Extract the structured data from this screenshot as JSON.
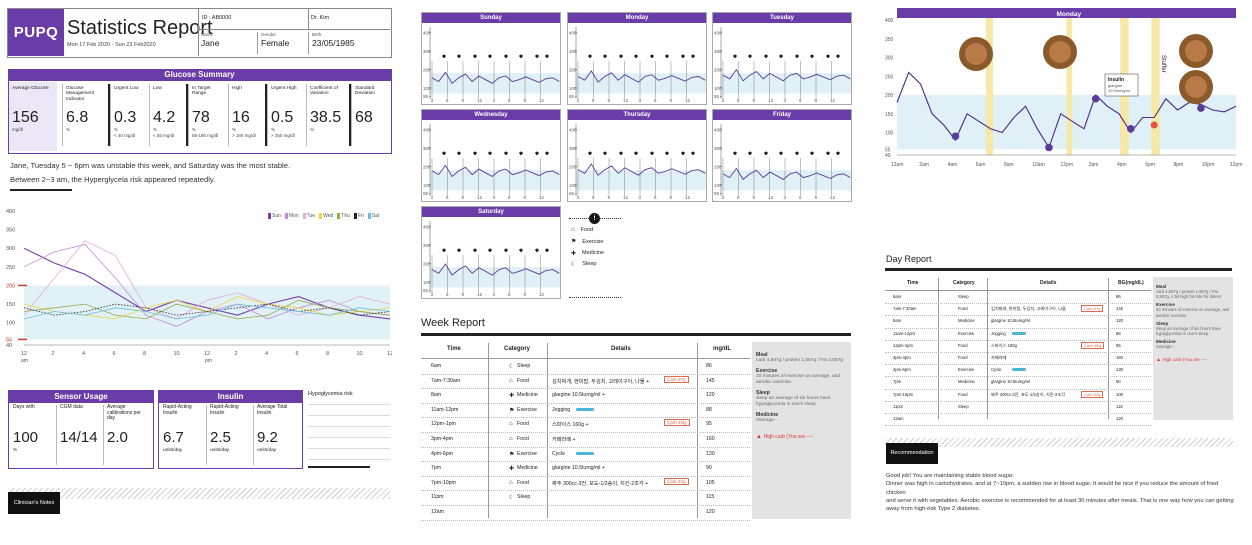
{
  "header": {
    "logo": "PUPQ",
    "title": "Statistics Report",
    "period": "Mon 17 Feb 2020 - Sun 23 Feb2020",
    "id": "ID : AB0000",
    "doctor": "Dr. Kim",
    "name_label": "Name",
    "name": "Jane",
    "gender_label": "Gender",
    "gender": "Female",
    "birth_label": "Birth",
    "birth": "23/05/1985"
  },
  "summary": {
    "title": "Glucose Summary",
    "cols": [
      {
        "name": "Average Glucose",
        "value": "156",
        "unit": "mg/dl",
        "range": ""
      },
      {
        "name": "Glucose Management Indicator",
        "value": "6.8",
        "unit": "%",
        "range": ""
      },
      {
        "name": "Urgent Low",
        "value": "0.3",
        "unit": "%",
        "range": "< 40 mg/dl"
      },
      {
        "name": "Low",
        "value": "4.2",
        "unit": "%",
        "range": "< 55 mg/dl"
      },
      {
        "name": "In Target Range",
        "value": "78",
        "unit": "%",
        "range": "55-180 mg/dl"
      },
      {
        "name": "High",
        "value": "16",
        "unit": "%",
        "range": "> 180 mg/dl"
      },
      {
        "name": "Urgent High",
        "value": "0.5",
        "unit": "%",
        "range": "> 250 mg/dl"
      },
      {
        "name": "Coefficient of Variation",
        "value": "38.5",
        "unit": "%",
        "range": ""
      },
      {
        "name": "Standard Deviation",
        "value": "68",
        "unit": "",
        "range": ""
      }
    ],
    "text1": "Jane, Tuesday 5 ~ 6pm was unstable this week, and Saturday was the most stable.",
    "text2": "Between 2~3 am, the Hyperglycela risk appeared repeatedly."
  },
  "weekly_chart": {
    "legend": [
      {
        "label": "Sun",
        "color": "#7b3fb0"
      },
      {
        "label": "Mon",
        "color": "#c58ad8"
      },
      {
        "label": "Tue",
        "color": "#e7a9df"
      },
      {
        "label": "Wed",
        "color": "#f1d640"
      },
      {
        "label": "Thu",
        "color": "#9aa94a"
      },
      {
        "label": "Fri",
        "color": "#222222"
      },
      {
        "label": "Sat",
        "color": "#6cc3d9"
      }
    ],
    "yticks": [
      "400",
      "350",
      "300",
      "250",
      "200",
      "150",
      "100",
      "55",
      "40"
    ],
    "xticks": [
      "12",
      "2",
      "4",
      "6",
      "8",
      "10",
      "12",
      "2",
      "4",
      "6",
      "8",
      "10",
      "12"
    ],
    "am": "am",
    "pm": "pm"
  },
  "sensor": {
    "title": "Sensor Usage",
    "cols": [
      {
        "name": "Days with",
        "value": "100",
        "unit": "%"
      },
      {
        "name": "CGM data",
        "value": "14/14",
        "unit": ""
      },
      {
        "name": "Average calibrations per day",
        "value": "2.0",
        "unit": ""
      }
    ]
  },
  "insulin": {
    "title": "Insulin",
    "cols": [
      {
        "name": "Rapid-Acting Insulin",
        "value": "6.7",
        "unit": "units/day"
      },
      {
        "name": "Rapid-Acting Insulin",
        "value": "2.5",
        "unit": "units/day"
      },
      {
        "name": "Average Total Insulin",
        "value": "9.2",
        "unit": "units/day"
      }
    ]
  },
  "hypo_label": "Hypoglycemia risk",
  "clinician_label": "Clinician's Notes",
  "mini_charts": {
    "days": [
      "Sunday",
      "Monday",
      "Tuesday",
      "Wednesday",
      "Thursday",
      "Friday",
      "Saturday"
    ],
    "yticks": [
      "400",
      "300",
      "200",
      "100",
      "55"
    ],
    "xticks": [
      "3",
      "6",
      "9",
      "12",
      "3",
      "6",
      "9",
      "12"
    ]
  },
  "legend_icons": {
    "info": "i",
    "items": [
      {
        "icon": "food-icon",
        "label": "Food"
      },
      {
        "icon": "exercise-icon",
        "label": "Exercise"
      },
      {
        "icon": "medicine-icon",
        "label": "Medicine"
      },
      {
        "icon": "sleep-icon",
        "label": "Sleep"
      }
    ]
  },
  "week_report": {
    "title": "Week Report",
    "headers": [
      "Time",
      "Category",
      "Details",
      "mg/dL"
    ],
    "rows": [
      {
        "time": "6am",
        "cat": "Sleep",
        "icon": "sleep-icon",
        "detail": "",
        "tag": "",
        "bar": false,
        "mg": "86"
      },
      {
        "time": "7am-7:30am",
        "cat": "Food",
        "icon": "food-icon",
        "detail": "김치찌개, 현미밥, 두김치, 고레이구이, 나물 +",
        "tag": "Carb 97g",
        "bar": false,
        "mg": "145"
      },
      {
        "time": "8am",
        "cat": "Medicine",
        "icon": "medicine-icon",
        "detail": "glargine 10.5Iumg/ml +",
        "tag": "",
        "bar": false,
        "mg": "120"
      },
      {
        "time": "11am-12pm",
        "cat": "Exercise",
        "icon": "exercise-icon",
        "detail": "Jogging",
        "tag": "",
        "bar": true,
        "mg": "88"
      },
      {
        "time": "12pm-1pm",
        "cat": "Food",
        "icon": "food-icon",
        "detail": "스파이스 160g +",
        "tag": "Carb 45lg",
        "bar": false,
        "mg": "95"
      },
      {
        "time": "3pm-4pm",
        "cat": "Food",
        "icon": "food-icon",
        "detail": "카페라떼 +",
        "tag": "",
        "bar": false,
        "mg": "160"
      },
      {
        "time": "4pm-6pm",
        "cat": "Exercise",
        "icon": "exercise-icon",
        "detail": "Cycle",
        "tag": "",
        "bar": true,
        "mg": "130"
      },
      {
        "time": "7pm",
        "cat": "Medicine",
        "icon": "medicine-icon",
        "detail": "glargine 10.5Iumg/ml +",
        "tag": "",
        "bar": false,
        "mg": "90"
      },
      {
        "time": "7pm-10pm",
        "cat": "Food",
        "icon": "food-icon",
        "detail": "짜주 300cc-3잔, 포도-1/2송이, 치킨-2조각 +",
        "tag": "Carb 23g",
        "bar": false,
        "mg": "105"
      },
      {
        "time": "11pm",
        "cat": "Sleep",
        "icon": "sleep-icon",
        "detail": "",
        "tag": "",
        "bar": false,
        "mg": "115"
      },
      {
        "time": "12am",
        "cat": "",
        "icon": "",
        "detail": "",
        "tag": "",
        "bar": false,
        "mg": "120"
      }
    ],
    "side": [
      {
        "h": "Meal",
        "t": "carb 4,567g / protein 1,567g / Fat 3,567g"
      },
      {
        "h": "Exercise",
        "t": "30 minutes of exercise on average, and aerobic exercise."
      },
      {
        "h": "Sleep",
        "t": "sleep an average of six hours have hypoglycemia in one's sleep"
      },
      {
        "h": "Medicine",
        "t": "Average--"
      }
    ],
    "warn": "High carb (You are ----"
  },
  "monday_chart": {
    "title": "Monday",
    "yticks": [
      "400",
      "350",
      "300",
      "250",
      "200",
      "150",
      "100",
      "55",
      "40"
    ],
    "xticks": [
      "12am",
      "2am",
      "4am",
      "6am",
      "8am",
      "10am",
      "12pm",
      "2pm",
      "4pm",
      "6pm",
      "8pm",
      "10pm",
      "12pm"
    ],
    "callout_title": "Insulin",
    "callout_l1": "glargine",
    "callout_l2": "10.5Iumg/ml",
    "side_text": "Stuffer"
  },
  "day_report": {
    "title": "Day Report",
    "headers": [
      "Time",
      "Category",
      "Details",
      "BG(mg/dL)"
    ],
    "rows": [
      {
        "time": "6am",
        "cat": "Sleep",
        "detail": "",
        "tag": "",
        "bar": false,
        "bg": "86"
      },
      {
        "time": "7am-7:30am",
        "cat": "Food",
        "detail": "김치찌개, 현미밥, 두김치, 고레이구이, 나물",
        "tag": "Carb 97g",
        "bar": false,
        "bg": "145"
      },
      {
        "time": "8am",
        "cat": "Medicine",
        "detail": "glargine 10.5Iumg/ml",
        "tag": "",
        "bar": false,
        "bg": "120"
      },
      {
        "time": "11am-12pm",
        "cat": "Exercise",
        "detail": "Jogging",
        "tag": "",
        "bar": true,
        "bg": "88"
      },
      {
        "time": "12pm-1pm",
        "cat": "Food",
        "detail": "스파이스 160g",
        "tag": "Carb 45lg",
        "bar": false,
        "bg": "95"
      },
      {
        "time": "3pm-4pm",
        "cat": "Food",
        "detail": "카페라떼",
        "tag": "",
        "bar": false,
        "bg": "160"
      },
      {
        "time": "4pm-6pm",
        "cat": "Exercise",
        "detail": "Cycle",
        "tag": "",
        "bar": true,
        "bg": "130"
      },
      {
        "time": "7pm",
        "cat": "Medicine",
        "detail": "glargine 10.5Iumg/ml",
        "tag": "",
        "bar": false,
        "bg": "90"
      },
      {
        "time": "7pm-10pm",
        "cat": "Food",
        "detail": "짜주 300cc-3잔, 포도-1/2송이, 치킨-2조각",
        "tag": "Carb 23g",
        "bar": false,
        "bg": "105"
      },
      {
        "time": "11pm",
        "cat": "Sleep",
        "detail": "",
        "tag": "",
        "bar": false,
        "bg": "115"
      },
      {
        "time": "12am",
        "cat": "",
        "detail": "",
        "tag": "",
        "bar": false,
        "bg": "120"
      }
    ],
    "side": [
      {
        "h": "Meal",
        "t": "carb 4,567g / protein 1,567g / Fat 3,567g, A bit high fat rate for dinner"
      },
      {
        "h": "Exercise",
        "t": "30 minutes of exercise on average, and aerobic exercise."
      },
      {
        "h": "Sleep",
        "t": "sleep an average of six hours have hypoglycemia in one's sleep"
      },
      {
        "h": "Medicine",
        "t": "Average--"
      }
    ],
    "warn": "High carb (You are ----"
  },
  "recommendation": {
    "title": "Recommendation",
    "l1": "Good job! You are maintaining stable blood sugar.",
    "l2": "Dinner was high in carbohydrates, and at 7~10pm, a sudden rise in blood sugar. It would be nice if you reduce the amount of fried chicken",
    "l3": "and serve it with vegetables. Aerobic exercise is recommended for at least 30 minutes after meals. That is one way how you can getting",
    "l4": "away from high-risk Type 2 diabetes."
  }
}
